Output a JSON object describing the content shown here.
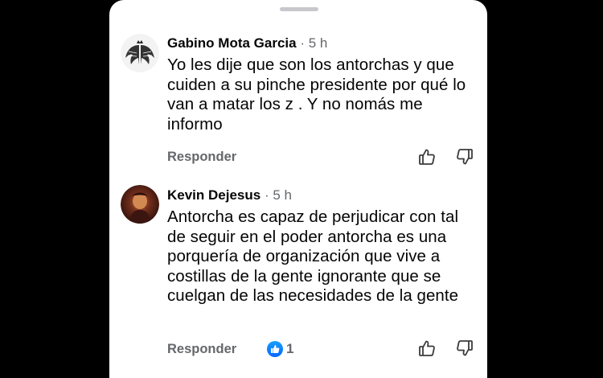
{
  "comments": [
    {
      "author": "Gabino Mota Garcia",
      "separator": "·",
      "time": "5 h",
      "text": "Yo les dije que son los antorchas y que cuiden a su pinche presidente por qué lo van a matar los z . Y no nomás me informo",
      "reply_label": "Responder",
      "avatar_icon": "winged-crown-avatar-icon"
    },
    {
      "author": "Kevin Dejesus",
      "separator": "·",
      "time": "5 h",
      "text": "Antorcha es capaz de perjudicar con tal de seguir en el poder antorcha es una porquería de organización que vive a costillas de la gente ignorante que se cuelgan de las necesidades de la gente",
      "reply_label": "Responder",
      "reaction_count": "1",
      "avatar_icon": "profile-photo-avatar-icon"
    }
  ],
  "colors": {
    "background": "#000000",
    "sheet": "#ffffff",
    "text": "#050505",
    "secondary": "#65676b",
    "like_blue": "#0866ff"
  }
}
